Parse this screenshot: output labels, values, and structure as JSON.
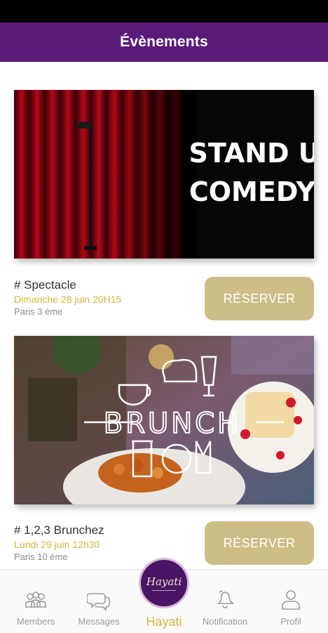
{
  "header": {
    "title": "Évènements"
  },
  "events": [
    {
      "image_text": [
        "STAND UP",
        "COMEDY"
      ],
      "title": "# Spectacle",
      "date": "Dimanche 28 juin 20H15",
      "location": "Paris 3 ème",
      "button": "RÉSERVER"
    },
    {
      "image_text": [
        "BRUNCH"
      ],
      "title": "# 1,2,3 Brunchez",
      "date": "Lundi 29 juin 12h30",
      "location": "Paris 10 ème",
      "button": "RÉSERVER"
    }
  ],
  "nav": {
    "items": [
      {
        "label": "Members",
        "icon": "members-icon"
      },
      {
        "label": "Messages",
        "icon": "messages-icon"
      },
      {
        "label": "Hayati",
        "icon": "hayati-logo",
        "logo_text": "Hayati"
      },
      {
        "label": "Notification",
        "icon": "bell-icon"
      },
      {
        "label": "Profil",
        "icon": "user-icon"
      }
    ]
  },
  "colors": {
    "header_bg": "#5a1a7a",
    "accent_gold": "#d9b43a",
    "button_bg": "#cdbd86",
    "nav_inactive": "#9a9a9a"
  }
}
